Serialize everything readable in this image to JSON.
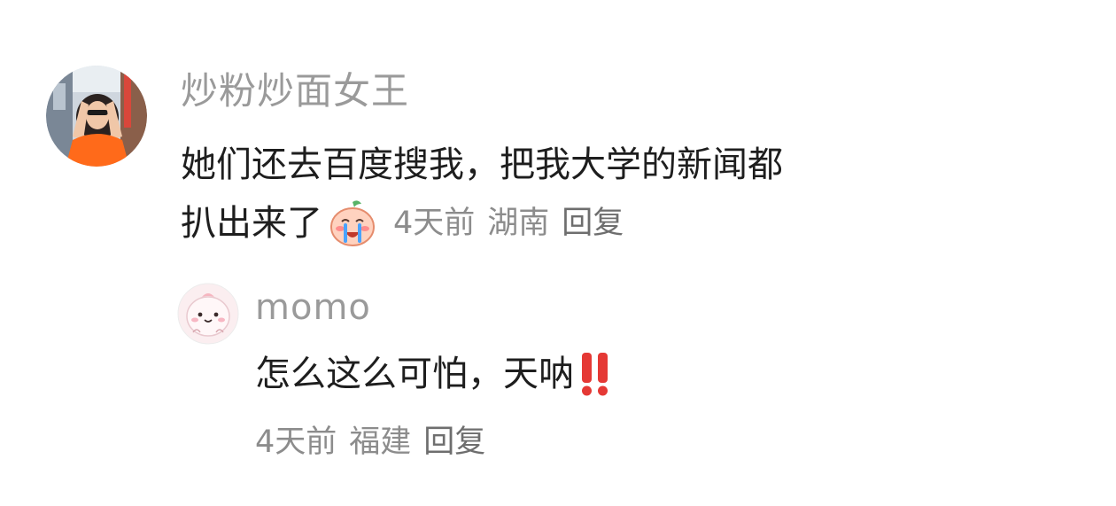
{
  "comments": [
    {
      "username": "炒粉炒面女王",
      "text_line1": "她们还去百度搜我，把我大学的新闻都",
      "text_line2": "扒出来了",
      "sticker": "crying-peach-sticker-icon",
      "time": "4天前",
      "location": "湖南",
      "reply_label": "回复"
    },
    {
      "username": "momo",
      "text": "怎么这么可怕，天呐",
      "emoji": "double-exclamation-icon",
      "time": "4天前",
      "location": "福建",
      "reply_label": "回复"
    }
  ],
  "colors": {
    "username": "#9a9a9a",
    "text": "#1e1e1e",
    "meta": "#8c8c8c",
    "exclamation": "#e53935",
    "avatar1_shirt": "#ff6a1a"
  }
}
